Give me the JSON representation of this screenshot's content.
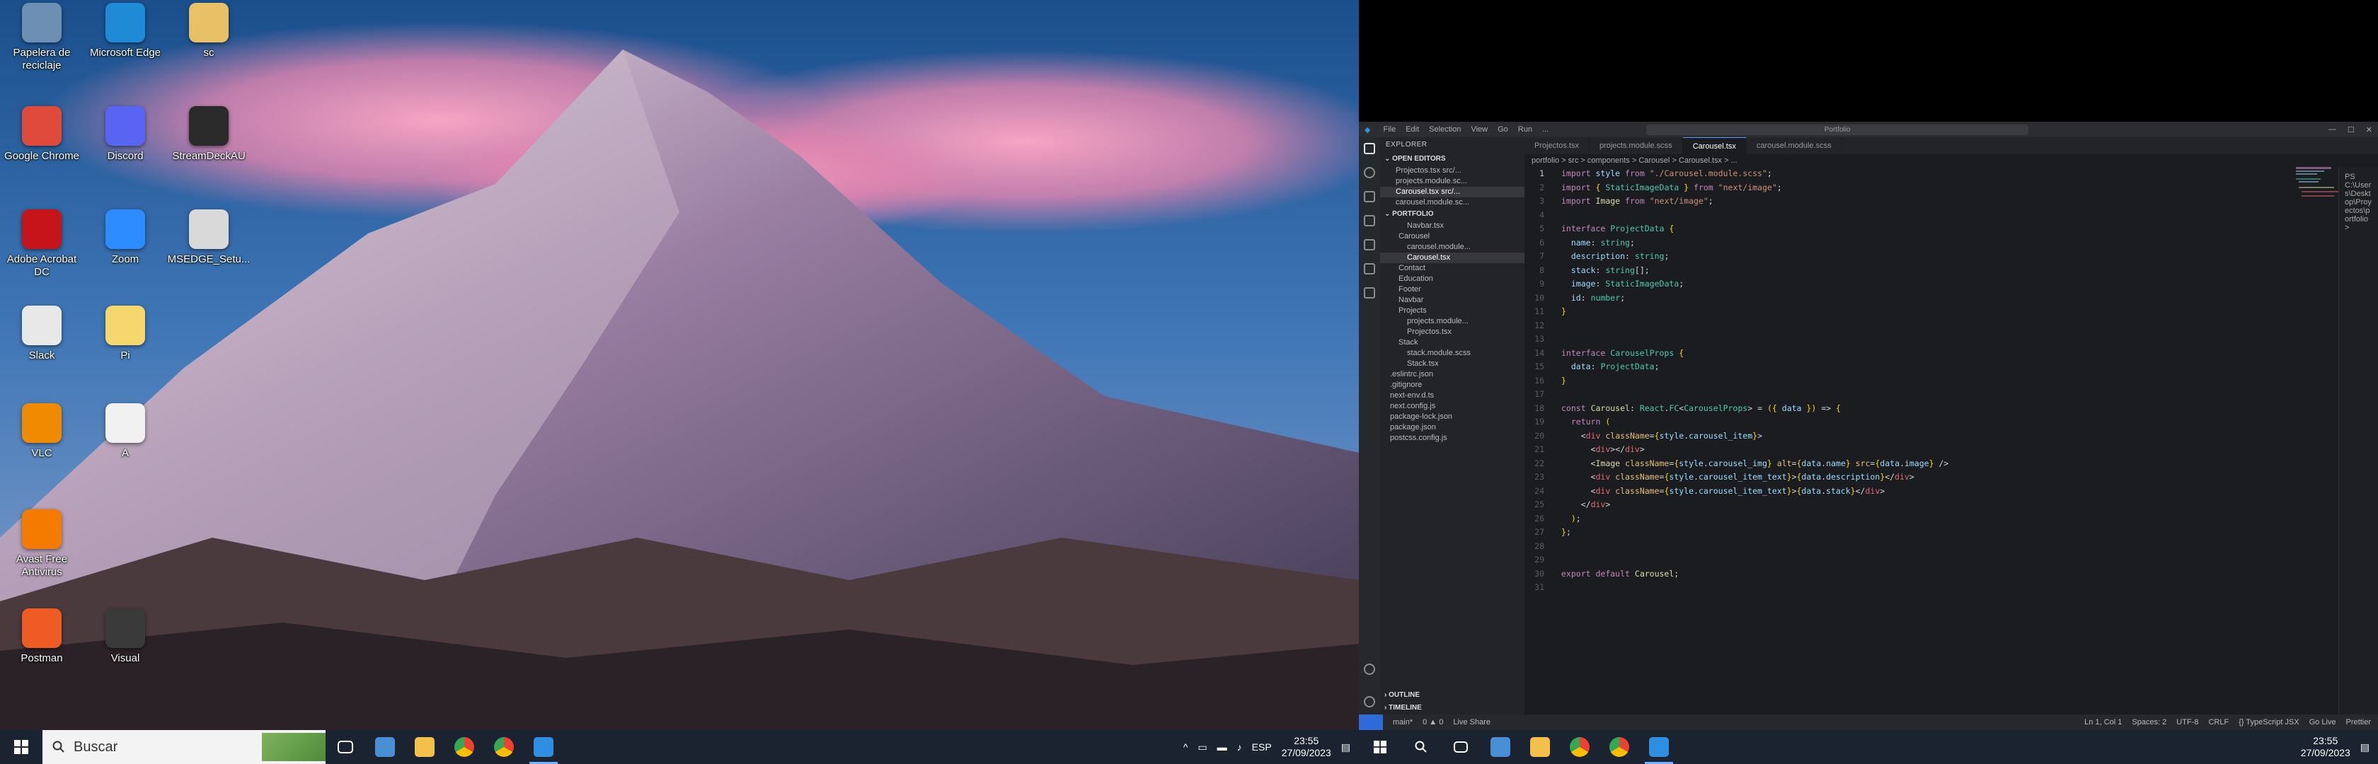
{
  "desktop": {
    "icons": [
      {
        "label": "Papelera de reciclaje",
        "icon": "recycle-bin-icon",
        "color": "#6d8fb3"
      },
      {
        "label": "Microsoft Edge",
        "icon": "edge-icon",
        "color": "#1f8ad6"
      },
      {
        "label": "sc",
        "icon": "folder-icon",
        "color": "#e8c065"
      },
      {
        "label": "Google Chrome",
        "icon": "chrome-icon",
        "color": "#e04a3a"
      },
      {
        "label": "Discord",
        "icon": "discord-icon",
        "color": "#5865f2"
      },
      {
        "label": "StreamDeckAU",
        "icon": "keyboard-icon",
        "color": "#2a2a2a"
      },
      {
        "label": "Adobe Acrobat DC",
        "icon": "acrobat-icon",
        "color": "#c7141b"
      },
      {
        "label": "Zoom",
        "icon": "zoom-icon",
        "color": "#2d8cff"
      },
      {
        "label": "MSEDGE_Setu...",
        "icon": "installer-icon",
        "color": "#d9d9d9"
      },
      {
        "label": "Slack",
        "icon": "slack-icon",
        "color": "#e8e8e8"
      },
      {
        "label": "Pi",
        "icon": "notes-icon",
        "color": "#f5d76e"
      },
      {
        "label": "VLC",
        "icon": "vlc-icon",
        "color": "#f08a00"
      },
      {
        "label": "A",
        "icon": "document-icon",
        "color": "#f1f1f1"
      },
      {
        "label": "Avast Free Antivirus",
        "icon": "avast-icon",
        "color": "#f57b00"
      },
      {
        "label": "Postman",
        "icon": "postman-icon",
        "color": "#ef5b25"
      },
      {
        "label": "Visual",
        "icon": "terminal-icon",
        "color": "#3a3a3a"
      }
    ]
  },
  "taskbar1": {
    "search_placeholder": "Buscar",
    "apps": [
      "task-view-icon",
      "file-explorer-icon",
      "folder-icon",
      "chrome-icon",
      "chrome-alt-icon",
      "vscode-icon"
    ],
    "time": "23:55",
    "date": "27/09/2023"
  },
  "vscode": {
    "menu": [
      "File",
      "Edit",
      "Selection",
      "View",
      "Go",
      "Run",
      "..."
    ],
    "command_center": "Portfolio",
    "sidebar_title": "EXPLORER",
    "open_editors_label": "OPEN EDITORS",
    "open_editors": [
      "Projectos.tsx src/...",
      "projects.module.sc...",
      "Carousel.tsx src/...",
      "carousel.module.sc..."
    ],
    "project_label": "PORTFOLIO",
    "tree": [
      {
        "text": "Navbar.tsx",
        "indent": 2
      },
      {
        "text": "Carousel",
        "indent": 1
      },
      {
        "text": "carousel.module...",
        "indent": 2
      },
      {
        "text": "Carousel.tsx",
        "indent": 2,
        "selected": true
      },
      {
        "text": "Contact",
        "indent": 1
      },
      {
        "text": "Education",
        "indent": 1
      },
      {
        "text": "Footer",
        "indent": 1
      },
      {
        "text": "Navbar",
        "indent": 1
      },
      {
        "text": "Projects",
        "indent": 1
      },
      {
        "text": "projects.module...",
        "indent": 2
      },
      {
        "text": "Projectos.tsx",
        "indent": 2
      },
      {
        "text": "Stack",
        "indent": 1
      },
      {
        "text": "stack.module.scss",
        "indent": 2
      },
      {
        "text": "Stack.tsx",
        "indent": 2
      },
      {
        "text": ".eslintrc.json",
        "indent": 0
      },
      {
        "text": ".gitignore",
        "indent": 0
      },
      {
        "text": "next-env.d.ts",
        "indent": 0
      },
      {
        "text": "next.config.js",
        "indent": 0
      },
      {
        "text": "package-lock.json",
        "indent": 0
      },
      {
        "text": "package.json",
        "indent": 0
      },
      {
        "text": "postcss.config.js",
        "indent": 0
      }
    ],
    "outline_label": "OUTLINE",
    "timeline_label": "TIMELINE",
    "tabs": [
      "Projectos.tsx",
      "projects.module.scss",
      "Carousel.tsx",
      "carousel.module.scss"
    ],
    "active_tab": 2,
    "breadcrumb": "portfolio > src > components > Carousel > Carousel.tsx > ...",
    "code": [
      "import style from \"./Carousel.module.scss\";",
      "import { StaticImageData } from \"next/image\";",
      "import Image from \"next/image\";",
      "",
      "interface ProjectData {",
      "  name: string;",
      "  description: string;",
      "  stack: string[];",
      "  image: StaticImageData;",
      "  id: number;",
      "}",
      "",
      "",
      "interface CarouselProps {",
      "  data: ProjectData;",
      "}",
      "",
      "const Carousel: React.FC<CarouselProps> = ({ data }) => {",
      "  return (",
      "    <div className={style.carousel_item}>",
      "      <div></div>",
      "      <Image className={style.carousel_img} alt={data.name} src={data.image} />",
      "      <div className={style.carousel_item_text}>{data.description}</div>",
      "      <div className={style.carousel_item_text}>{data.stack}</div>",
      "    </div>",
      "  );",
      "};",
      "",
      "",
      "export default Carousel;",
      ""
    ],
    "side_panel_text": "PS C:\\Users\\Desktop\\Proyectos\\portfolio>",
    "status_left": [
      "main*",
      "0 ▲ 0",
      "Live Share"
    ],
    "status_right": [
      "Ln 1, Col 1",
      "Spaces: 2",
      "UTF-8",
      "CRLF",
      "{} TypeScript JSX",
      "Go Live",
      "Prettier"
    ],
    "accent": "#2f6bd8"
  },
  "taskbar2": {
    "apps": [
      "search-icon",
      "task-view-icon",
      "file-explorer-icon",
      "folder-icon",
      "chrome-icon",
      "chrome-alt-icon",
      "vscode-icon"
    ],
    "time": "23:55",
    "date": "27/09/2023"
  }
}
